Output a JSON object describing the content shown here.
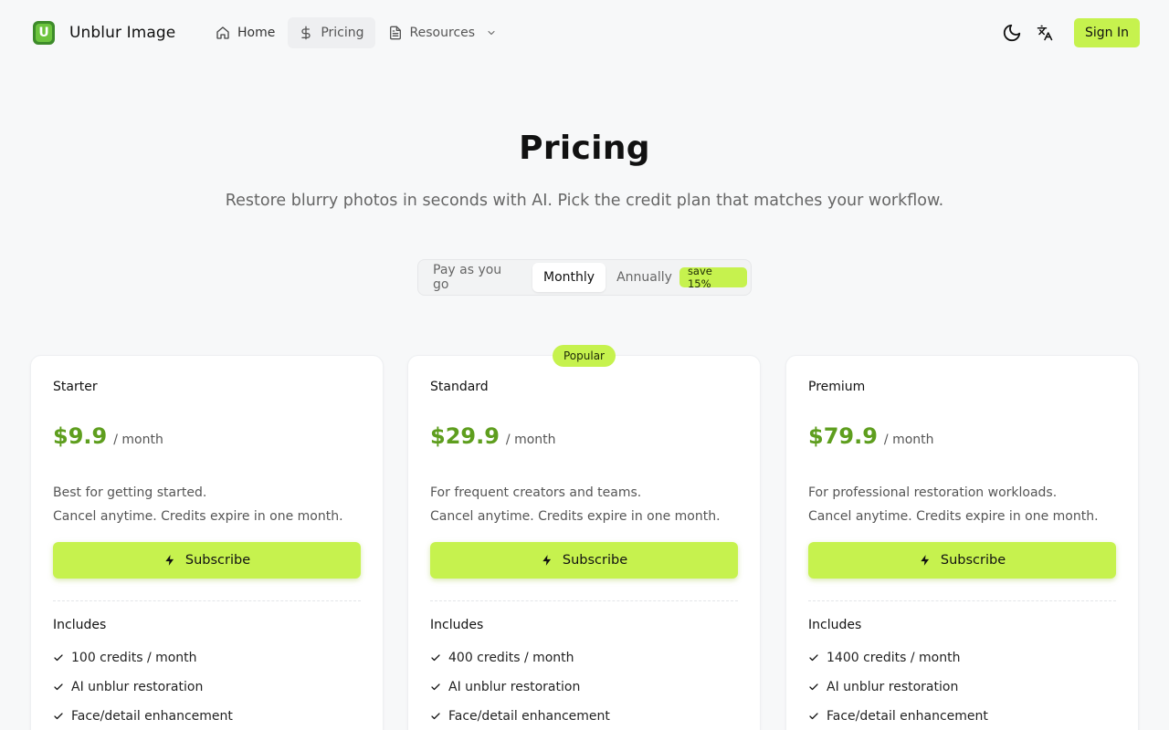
{
  "header": {
    "brand": "Unblur Image",
    "logo_letter": "U",
    "nav": [
      {
        "label": "Home",
        "icon": "home-icon"
      },
      {
        "label": "Pricing",
        "icon": "dollar-icon"
      },
      {
        "label": "Resources",
        "icon": "document-icon"
      }
    ],
    "sign_in": "Sign In"
  },
  "hero": {
    "title": "Pricing",
    "subtitle": "Restore blurry photos in seconds with AI. Pick the credit plan that matches your workflow."
  },
  "billing": {
    "options": [
      "Pay as you go",
      "Monthly",
      "Annually"
    ],
    "selected": "Monthly",
    "save_badge": "save 15%"
  },
  "plans": [
    {
      "name": "Starter",
      "price": "$9.9",
      "period": "/ month",
      "desc1": "Best for getting started.",
      "desc2": "Cancel anytime. Credits expire in one month.",
      "cta": "Subscribe",
      "includes": "Includes",
      "features": [
        "100 credits / month",
        "AI unblur restoration",
        "Face/detail enhancement"
      ]
    },
    {
      "name": "Standard",
      "badge": "Popular",
      "price": "$29.9",
      "period": "/ month",
      "desc1": "For frequent creators and teams.",
      "desc2": "Cancel anytime. Credits expire in one month.",
      "cta": "Subscribe",
      "includes": "Includes",
      "features": [
        "400 credits / month",
        "AI unblur restoration",
        "Face/detail enhancement"
      ]
    },
    {
      "name": "Premium",
      "price": "$79.9",
      "period": "/ month",
      "desc1": "For professional restoration workloads.",
      "desc2": "Cancel anytime. Credits expire in one month.",
      "cta": "Subscribe",
      "includes": "Includes",
      "features": [
        "1400 credits / month",
        "AI unblur restoration",
        "Face/detail enhancement"
      ]
    }
  ],
  "colors": {
    "accent": "#c6f24e",
    "price": "#5e9e1e",
    "background": "#f7f8f9"
  }
}
